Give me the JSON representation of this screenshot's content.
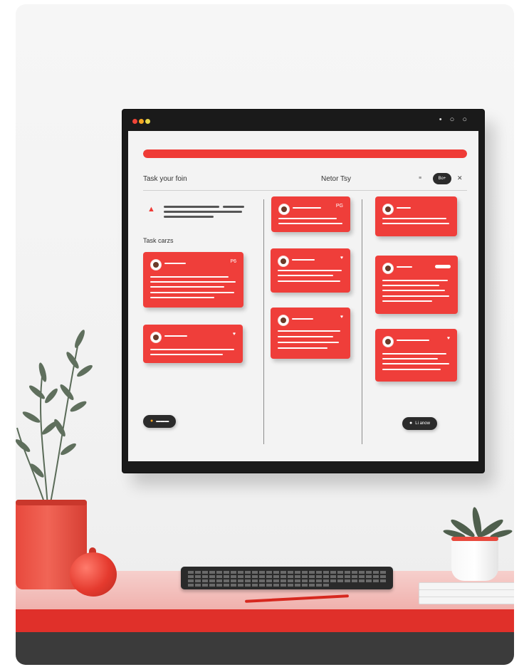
{
  "window": {
    "controls": [
      "close-dot",
      "minimize-dot",
      "maximize-dot"
    ],
    "top_right_icons": "• ○ ○"
  },
  "board": {
    "progress_percent": 100,
    "title": "Task your foin",
    "date_label": "Netor Tsy",
    "small_label": "≡",
    "pill_label": "Bo+",
    "close_glyph": "✕",
    "section_label": "Task carzs",
    "left_column": {
      "cards": [
        {
          "corner": "P6"
        },
        {
          "corner": "♥"
        }
      ],
      "button_icon": "●",
      "button_label": "▬▬▬"
    },
    "middle_column": {
      "cards": [
        {
          "corner": "PG"
        },
        {
          "corner": "♥"
        },
        {
          "corner": "♥"
        }
      ]
    },
    "right_column": {
      "cards": [
        {
          "corner": ""
        },
        {
          "corner": ""
        },
        {
          "corner": "♥"
        }
      ],
      "button_icon": "●",
      "button_label": "Li anow"
    }
  },
  "colors": {
    "accent": "#ef3b36",
    "monitor_frame": "#1a1a1a",
    "screen_bg": "#f3f3f3",
    "dark_button": "#2b2b2b"
  }
}
